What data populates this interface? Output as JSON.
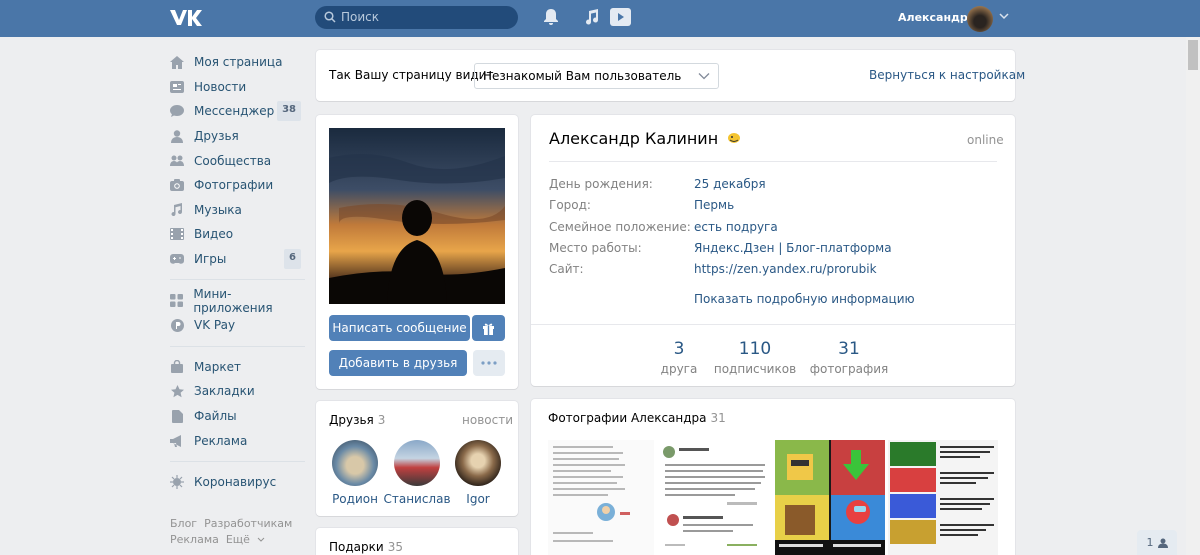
{
  "header": {
    "search_placeholder": "Поиск",
    "username": "Александр"
  },
  "nav": {
    "items": [
      {
        "label": "Моя страница",
        "icon": "home-icon"
      },
      {
        "label": "Новости",
        "icon": "news-icon"
      },
      {
        "label": "Мессенджер",
        "icon": "messenger-icon",
        "badge": "38"
      },
      {
        "label": "Друзья",
        "icon": "friends-icon"
      },
      {
        "label": "Сообщества",
        "icon": "groups-icon"
      },
      {
        "label": "Фотографии",
        "icon": "camera-icon"
      },
      {
        "label": "Музыка",
        "icon": "music-icon"
      },
      {
        "label": "Видео",
        "icon": "video-icon"
      },
      {
        "label": "Игры",
        "icon": "games-icon",
        "badge": "6"
      }
    ],
    "items2": [
      {
        "label": "Мини-приложения",
        "icon": "apps-icon"
      },
      {
        "label": "VK Pay",
        "icon": "vkpay-icon"
      }
    ],
    "items3": [
      {
        "label": "Маркет",
        "icon": "market-icon"
      },
      {
        "label": "Закладки",
        "icon": "star-icon"
      },
      {
        "label": "Файлы",
        "icon": "file-icon"
      },
      {
        "label": "Реклама",
        "icon": "megaphone-icon"
      }
    ],
    "items4": [
      {
        "label": "Коронавирус",
        "icon": "virus-icon"
      }
    ],
    "footer": [
      "Блог",
      "Разработчикам",
      "Реклама",
      "Ещё"
    ]
  },
  "viewbar": {
    "label": "Так Вашу страницу видит",
    "selected": "Незнакомый Вам пользователь",
    "return_link": "Вернуться к настройкам"
  },
  "profile": {
    "name": "Александр Калинин",
    "status": "online",
    "send_message": "Написать сообщение",
    "add_friend": "Добавить в друзья",
    "info": [
      {
        "label": "День рождения:",
        "value": "25 декабря"
      },
      {
        "label": "Город:",
        "value": "Пермь"
      },
      {
        "label": "Семейное положение:",
        "value": "есть подруга"
      },
      {
        "label": "Место работы:",
        "value": "Яндекс.Дзен | Блог-платформа"
      },
      {
        "label": "Сайт:",
        "value": "https://zen.yandex.ru/prorubik"
      }
    ],
    "show_more": "Показать подробную информацию",
    "stats": [
      {
        "num": "3",
        "label": "друга"
      },
      {
        "num": "110",
        "label": "подписчиков"
      },
      {
        "num": "31",
        "label": "фотография"
      }
    ]
  },
  "friends": {
    "title": "Друзья",
    "count": "3",
    "news": "новости",
    "list": [
      "Родион",
      "Станислав",
      "Igor"
    ]
  },
  "gifts": {
    "title": "Подарки",
    "count": "35"
  },
  "photos": {
    "title": "Фотографии Александра",
    "count": "31"
  },
  "floating": {
    "label": "1"
  }
}
